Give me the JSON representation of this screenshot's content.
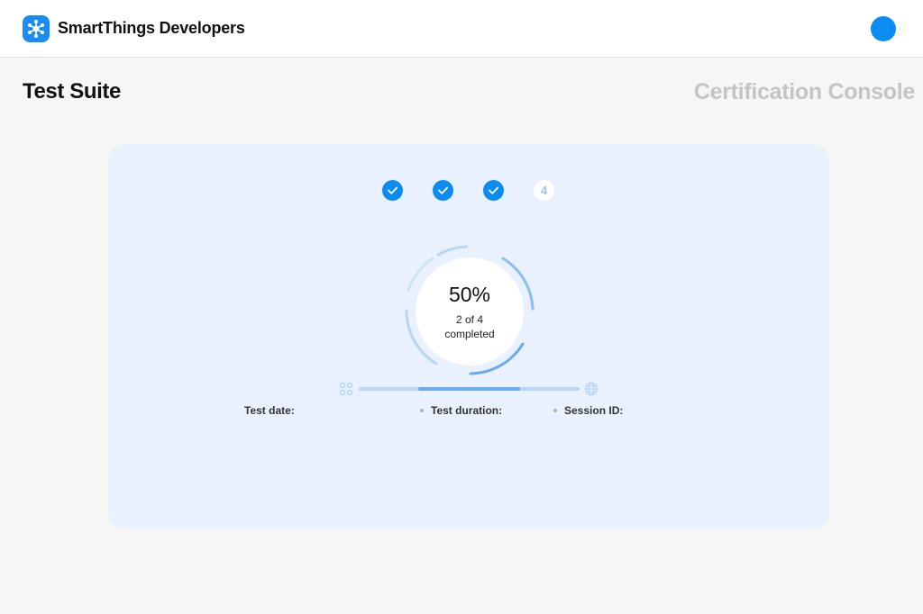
{
  "header": {
    "brand": "SmartThings Developers",
    "logo_icon": "smartthings-hub-icon",
    "avatar_color": "#0b8cf3"
  },
  "page": {
    "title": "Test Suite",
    "console": "Certification Console"
  },
  "stepper": {
    "steps": [
      {
        "state": "done",
        "icon": "check-icon"
      },
      {
        "state": "done",
        "icon": "check-icon"
      },
      {
        "state": "done",
        "icon": "check-icon"
      },
      {
        "state": "pending",
        "label": "4"
      }
    ]
  },
  "progress": {
    "percent_text": "50%",
    "percent": 50,
    "count_text": "2 of 4",
    "status_text": "completed"
  },
  "meta": {
    "test_date_label": "Test date:",
    "test_duration_label": "Test duration:",
    "session_id_label": "Session ID:"
  },
  "colors": {
    "accent": "#0b8cf3",
    "card_background": "#e8f1fd",
    "muted_text": "#c4c4c4"
  }
}
